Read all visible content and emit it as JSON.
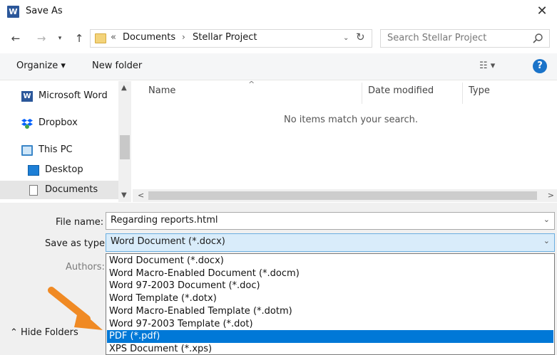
{
  "window": {
    "title": "Save As",
    "app_icon": "W",
    "close_glyph": "✕"
  },
  "address": {
    "overflow": "«",
    "crumbs": [
      "Documents",
      "Stellar Project"
    ],
    "separator": "›",
    "search_placeholder": "Search Stellar Project"
  },
  "toolbar": {
    "organize": "Organize ▾",
    "new_folder": "New folder",
    "view": "☷ ▾",
    "help": "?"
  },
  "nav": {
    "items": [
      {
        "label": "Microsoft Word",
        "icon": "word-icon"
      },
      {
        "label": "Dropbox",
        "icon": "dropbox-icon"
      },
      {
        "label": "This PC",
        "icon": "pc-icon"
      },
      {
        "label": "Desktop",
        "icon": "desktop-icon"
      },
      {
        "label": "Documents",
        "icon": "documents-icon"
      }
    ]
  },
  "filelist": {
    "columns": [
      "Name",
      "Date modified",
      "Type"
    ],
    "empty_message": "No items match your search."
  },
  "form": {
    "file_name_label": "File name:",
    "file_name_value": "Regarding reports.html",
    "save_type_label": "Save as type:",
    "save_type_value": "Word Document (*.docx)",
    "authors_label": "Authors:",
    "hide_folders": "Hide Folders"
  },
  "dropdown": {
    "options": [
      "Word Document (*.docx)",
      "Word Macro-Enabled Document (*.docm)",
      "Word 97-2003 Document (*.doc)",
      "Word Template (*.dotx)",
      "Word Macro-Enabled Template (*.dotm)",
      "Word 97-2003 Template (*.dot)",
      "PDF (*.pdf)",
      "XPS Document (*.xps)"
    ],
    "selected": "PDF (*.pdf)"
  },
  "colors": {
    "accent": "#0078d7",
    "arrow": "#f08a24",
    "help": "#1a73c9"
  }
}
